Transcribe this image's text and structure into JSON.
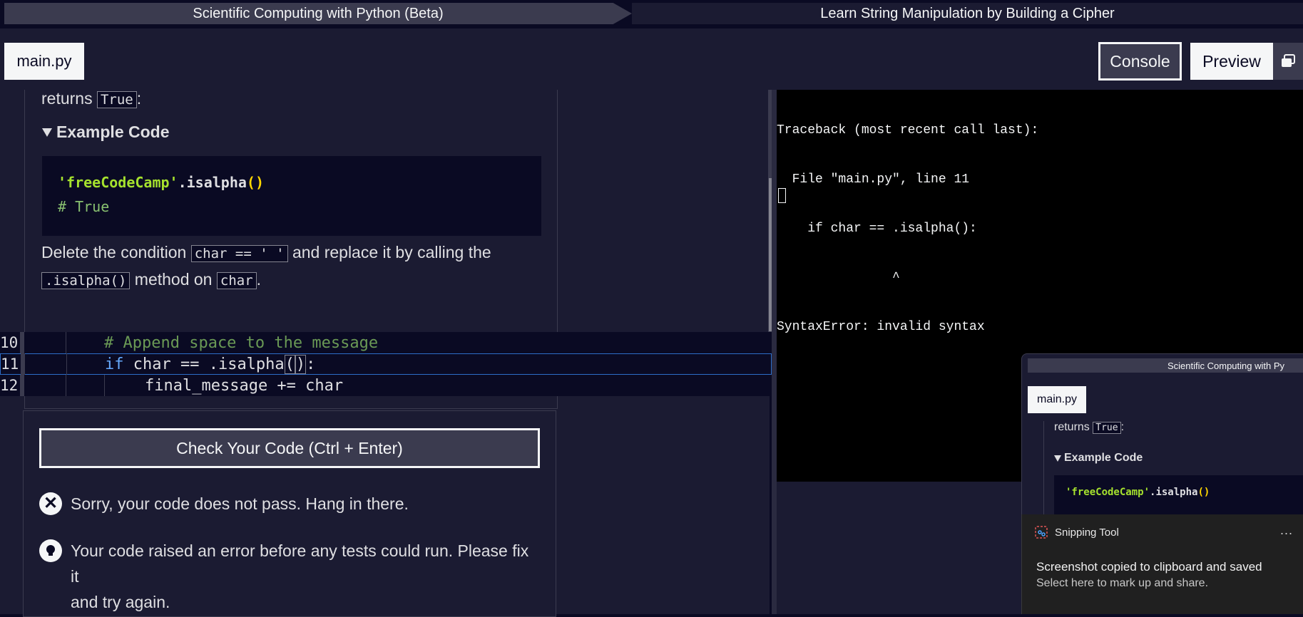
{
  "breadcrumb": {
    "course": "Scientific Computing with Python (Beta)",
    "project": "Learn String Manipulation by Building a Cipher"
  },
  "editor_tab": {
    "filename": "main.py"
  },
  "toolbar": {
    "console_label": "Console",
    "preview_label": "Preview",
    "popout_icon": "popout-window-icon"
  },
  "instructions": {
    "returns_prefix": "returns",
    "returns_value": "True",
    "returns_suffix": ":",
    "example_heading": "Example Code",
    "example_code": {
      "string": "'freeCodeCamp'",
      "method": ".isalpha",
      "parens": "()",
      "comment": "# True"
    },
    "para_part1": "Delete the condition",
    "para_code1": "char == ' '",
    "para_part2": "and replace it by calling the",
    "para_code2": ".isalpha()",
    "para_part3": "method on",
    "para_code3": "char",
    "para_part4": "."
  },
  "code_editor": {
    "lines": [
      {
        "number": "10",
        "text": "# Append space to the message"
      },
      {
        "number": "11",
        "kw": "if",
        "text_before": " char == .isalpha",
        "paren_open": "(",
        "paren_close": ")",
        "text_after": ":"
      },
      {
        "number": "12",
        "text": "final_message += char"
      }
    ]
  },
  "test_panel": {
    "check_button": "Check Your Code (Ctrl + Enter)",
    "fail_message": "Sorry, your code does not pass. Hang in there.",
    "hint_line1": "Your code raised an error before any tests could run. Please fix it",
    "hint_line2": "and try again."
  },
  "console": {
    "lines": [
      "Traceback (most recent call last):",
      "  File \"main.py\", line 11",
      "    if char == .isalpha():",
      "               ^",
      "SyntaxError: invalid syntax"
    ]
  },
  "thumbnail": {
    "crumb": "Scientific Computing with Py",
    "tab": "main.py",
    "returns_prefix": "returns",
    "returns_value": "True",
    "returns_suffix": ":",
    "example_heading": "Example Code",
    "code_string": "'freeCodeCamp'",
    "code_method": ".isalpha",
    "code_parens": "()"
  },
  "toast": {
    "app_name": "Snipping Tool",
    "more": "...",
    "title": "Screenshot copied to clipboard and saved",
    "body": "Select here to mark up and share."
  },
  "colors": {
    "background": "#0a0a23",
    "panel": "#1b1b32",
    "button": "#3b3b4f",
    "string_green": "#a6e22e",
    "paren_yellow": "#ffd700",
    "keyword_blue": "#66aaff",
    "active_line_border": "#2d6dc8"
  }
}
